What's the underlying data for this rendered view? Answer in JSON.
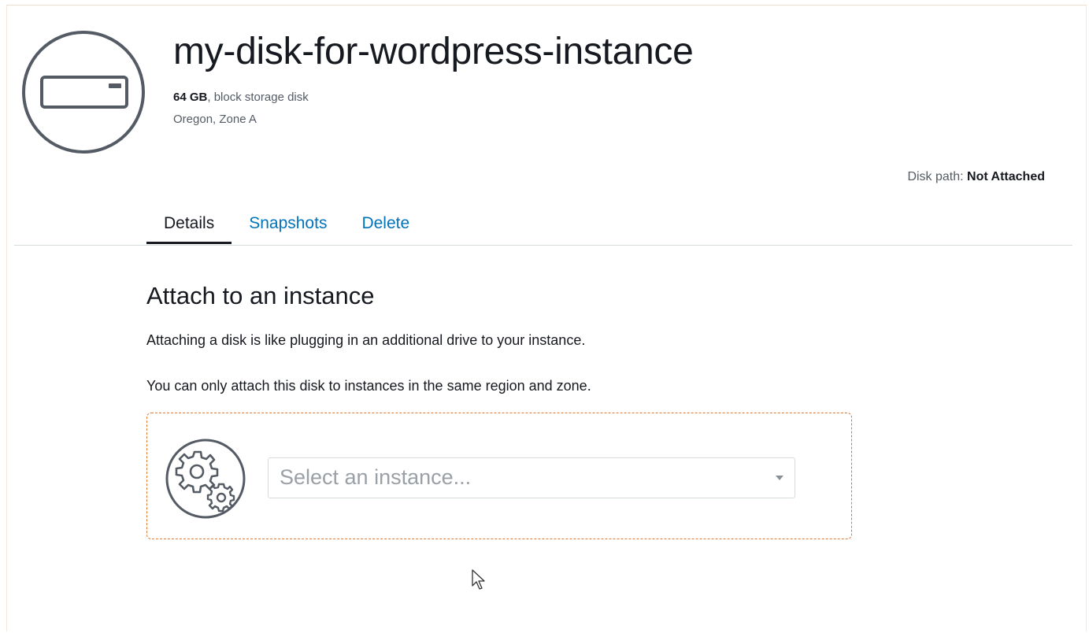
{
  "disk": {
    "name": "my-disk-for-wordpress-instance",
    "size": "64 GB",
    "type_suffix": ", block storage disk",
    "location": "Oregon, Zone A",
    "icon": "disk-drive-icon"
  },
  "disk_path": {
    "label": "Disk path:",
    "value": "Not Attached"
  },
  "tabs": [
    {
      "label": "Details",
      "active": true
    },
    {
      "label": "Snapshots",
      "active": false
    },
    {
      "label": "Delete",
      "active": false
    }
  ],
  "attach": {
    "title": "Attach to an instance",
    "description_1": "Attaching a disk is like plugging in an additional drive to your instance.",
    "description_2": "You can only attach this disk to instances in the same region and zone.",
    "icon": "gears-icon",
    "select_placeholder": "Select an instance..."
  },
  "colors": {
    "link": "#0073bb",
    "text": "#16191f",
    "muted": "#545b64",
    "accent_border": "#e07a2e"
  }
}
